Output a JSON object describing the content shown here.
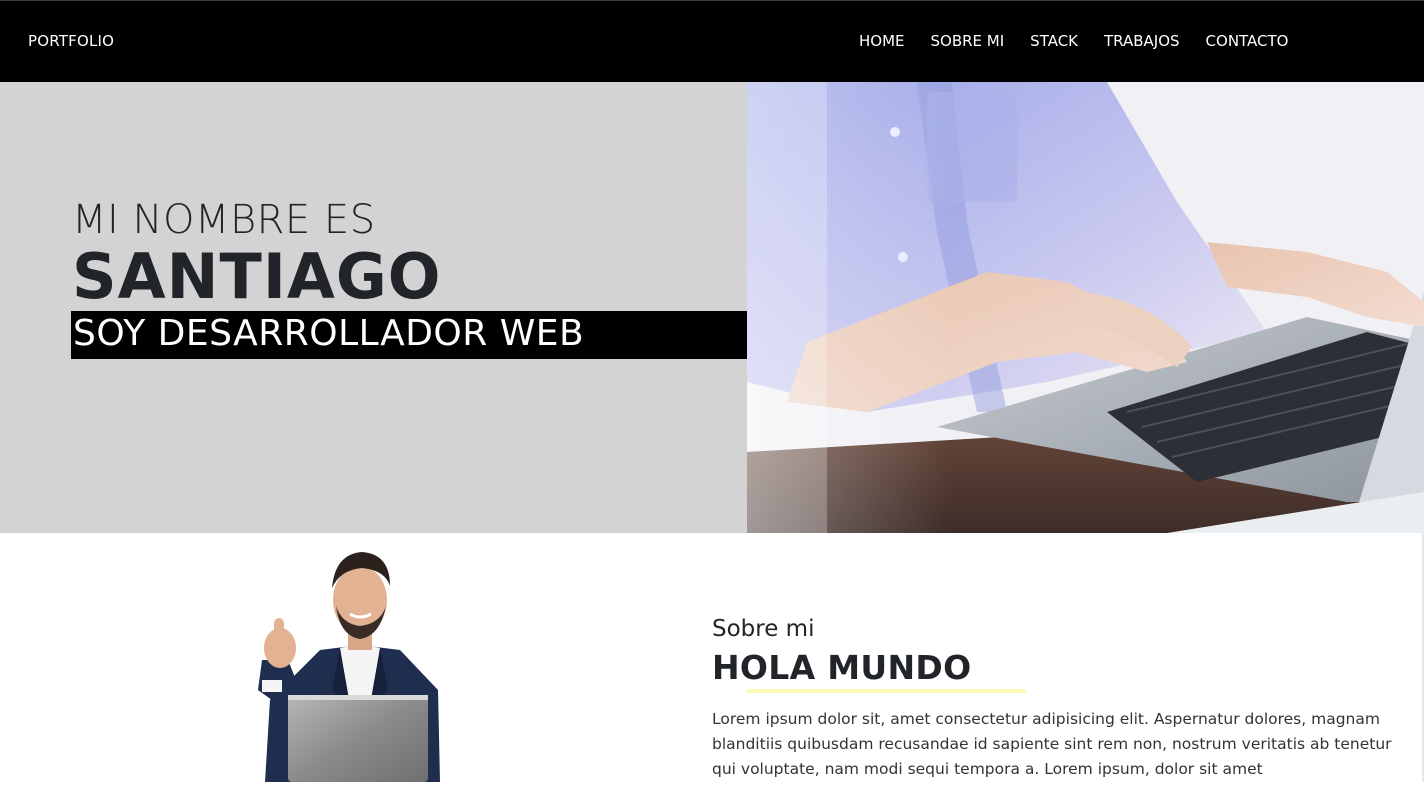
{
  "navbar": {
    "brand": "PORTFOLIO",
    "links": [
      "HOME",
      "SOBRE MI",
      "STACK",
      "TRABAJOS",
      "CONTACTO"
    ]
  },
  "hero": {
    "intro": "MI NOMBRE ES",
    "name": "SANTIAGO",
    "role": "SOY DESARROLLADOR WEB"
  },
  "about": {
    "kicker": "Sobre mi",
    "title": "HOLA MUNDO",
    "body": "Lorem ipsum dolor sit, amet consectetur adipisicing elit. Aspernatur dolores, magnam blanditiis quibusdam recusandae id sapiente sint rem non, nostrum veritatis ab tenetur qui voluptate, nam modi sequi tempora a. Lorem ipsum, dolor sit amet"
  },
  "colors": {
    "navbar_bg": "#000000",
    "hero_left_bg": "#d3d3d3",
    "role_bg": "#000000",
    "underline": "#fbf9b8"
  }
}
